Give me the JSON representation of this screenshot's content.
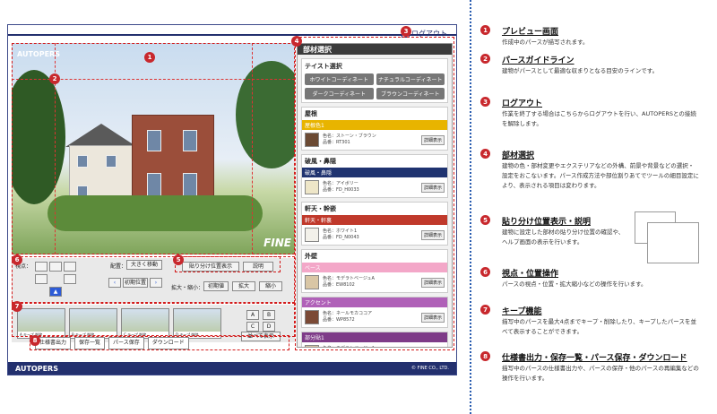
{
  "app": {
    "logout_label": "ログアウト",
    "brand_top": "AUTOPERS",
    "fine_logo": "FINE",
    "footer_logo": "AUTOPERS",
    "footer_copy": "© FINE CO., LTD."
  },
  "panel": {
    "title": "部材選択",
    "taste_title": "テイスト選択",
    "taste_buttons": [
      "ホワイトコーディネート",
      "ナチュラルコーディネート",
      "ダークコーディネート",
      "ブラウンコーディネート"
    ],
    "sections": [
      {
        "title": "屋根",
        "bar": "屋根色1",
        "bar_color": "#e8b400",
        "desc1": "色名：ストーン・ブラウン",
        "desc2": "品番：RT301",
        "btn": "詳細表示",
        "swatch": "#6b4a34"
      },
      {
        "title": "破風・鼻隠",
        "bar": "破風・鼻隠",
        "bar_color": "#1f3370",
        "desc1": "色名：アイボリー",
        "desc2": "品番：FD_H0033",
        "btn": "詳細表示",
        "swatch": "#eee6c8"
      },
      {
        "title": "軒天・幹嵌",
        "bar": "軒天・軒裏",
        "bar_color": "#c0392b",
        "desc1": "色名：ホワイト1",
        "desc2": "品番：FD_N0043",
        "btn": "詳細表示",
        "swatch": "#f3f1ea"
      },
      {
        "title": "外壁",
        "bar": "ベース",
        "bar_color": "#f3a7c8",
        "desc1": "色名：モデラトベージュA",
        "desc2": "品番：EW8102",
        "btn": "詳細表示",
        "swatch": "#d9c6a5"
      },
      {
        "title": "",
        "bar": "アクセント",
        "bar_color": "#b061b8",
        "desc1": "色名：ネールモカココア",
        "desc2": "品番：WP8572",
        "btn": "詳細表示",
        "swatch": "#7b4a36"
      },
      {
        "title": "",
        "bar": "部分貼1",
        "bar_color": "#7e3b88",
        "desc1": "色名：モデラトベージュA",
        "desc2": "品番：EW8102",
        "btn": "詳細表示",
        "swatch": "#d9c6a5"
      }
    ]
  },
  "viewpoint": {
    "label": "視点：",
    "layout_label": "配置：",
    "layout_value": "大きく移動",
    "reset_label": "初期位置",
    "zoom_label": "拡大・縮小：",
    "zoom_init": "初期値",
    "zoom_in": "拡大",
    "zoom_out": "縮小",
    "paste_toggle": "貼り分け位置表示",
    "help": "説明",
    "reset_pos": "初期位置"
  },
  "thumbs": {
    "items": [
      {
        "letter": "A",
        "keep": "キープ",
        "delete": "削除"
      },
      {
        "letter": "B",
        "keep": "キープ",
        "delete": "削除"
      },
      {
        "letter": "C",
        "keep": "キープ",
        "delete": "削除"
      },
      {
        "letter": "D",
        "keep": "キープ",
        "delete": "削除"
      }
    ],
    "compare": "並べて表示",
    "letters": [
      "A",
      "B",
      "C",
      "D"
    ]
  },
  "bottom": {
    "buttons": [
      "仕様書出力",
      "保存一覧",
      "パース保存",
      "ダウンロード"
    ]
  },
  "badges": [
    "1",
    "2",
    "3",
    "4",
    "5",
    "6",
    "7",
    "8"
  ],
  "explanations": [
    {
      "num": "1",
      "title": "プレビュー画面",
      "desc": "作成中のパースが描写されます。"
    },
    {
      "num": "2",
      "title": "パースガイドライン",
      "desc": "建物がパースとして最適な収まりとなる目安のラインです。"
    },
    {
      "num": "3",
      "title": "ログアウト",
      "desc": "作業を終了する場合はこちらからログアウトを行い、AUTOPERSとの接続を解除します。"
    },
    {
      "num": "4",
      "title": "部材選択",
      "desc": "建物の色・部材変更やエクステリアなどの外構、前景や背景などの選択・設定をおこないます。パース作成方法や部位割りあてでツールの細目設定により、表示される項目は変わります。"
    },
    {
      "num": "5",
      "title": "貼り分け位置表示・説明",
      "desc": "建物に設定した部材の貼り分け位置の確認や、ヘルプ画面の表示を行います。"
    },
    {
      "num": "6",
      "title": "視点・位置操作",
      "desc": "パースの視点・位置・拡大縮小などの操作を行います。"
    },
    {
      "num": "7",
      "title": "キープ機能",
      "desc": "描写中のパースを最大4点までキープ・削除したり、キープしたパースを並べて表示することができます。"
    },
    {
      "num": "8",
      "title": "仕様書出力・保存一覧・パース保存・ダウンロード",
      "desc": "描写中のパースの仕様書出力や、パースの保存・他のパースの再編集などの操作を行います。"
    }
  ]
}
